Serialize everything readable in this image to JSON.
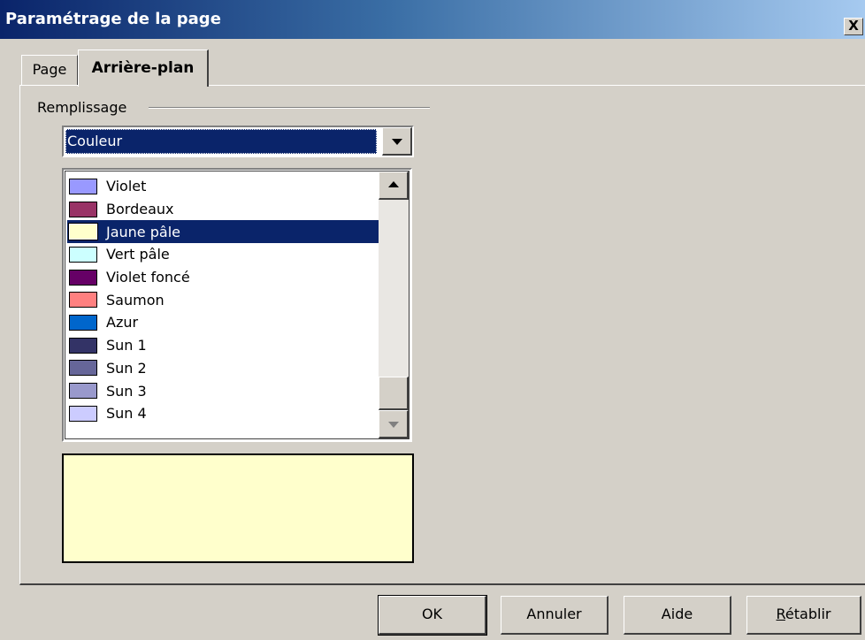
{
  "window": {
    "title": "Paramétrage de la page",
    "close_label": "X"
  },
  "tabs": [
    {
      "label": "Page"
    },
    {
      "label": "Arrière-plan"
    }
  ],
  "fill": {
    "group_label": "Remplissage",
    "type_selected": "Couleur",
    "colors": [
      {
        "name": "Violet",
        "color": "#9999ff"
      },
      {
        "name": "Bordeaux",
        "color": "#993366"
      },
      {
        "name": "Jaune pâle",
        "color": "#ffffcc"
      },
      {
        "name": "Vert pâle",
        "color": "#ccffff"
      },
      {
        "name": "Violet foncé",
        "color": "#660066"
      },
      {
        "name": "Saumon",
        "color": "#ff8080"
      },
      {
        "name": "Azur",
        "color": "#0066cc"
      },
      {
        "name": "Sun 1",
        "color": "#333366"
      },
      {
        "name": "Sun 2",
        "color": "#666699"
      },
      {
        "name": "Sun 3",
        "color": "#9999cc"
      },
      {
        "name": "Sun 4",
        "color": "#ccccff"
      }
    ],
    "selected_color": "Jaune pâle",
    "preview_color": "#ffffcc"
  },
  "buttons": {
    "ok": "OK",
    "cancel": "Annuler",
    "help": "Aide",
    "reset": "Rétablir"
  }
}
